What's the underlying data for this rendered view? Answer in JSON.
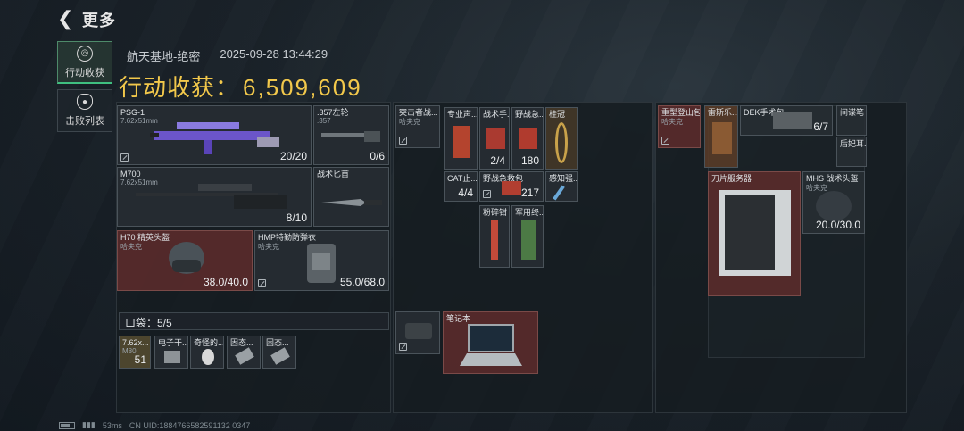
{
  "header": {
    "back_icon": "chevron-left-icon",
    "title": "更多"
  },
  "tabs": [
    {
      "label": "行动收获",
      "icon": "loot-icon",
      "active": true
    },
    {
      "label": "击败列表",
      "icon": "skull-icon",
      "active": false
    }
  ],
  "match": {
    "map": "航天基地-绝密",
    "datetime": "2025-09-28 13:44:29"
  },
  "earnings": {
    "label": "行动收获：",
    "value": "6,509,609"
  },
  "equipment": {
    "weapon1": {
      "name": "PSG-1",
      "caliber": "7.62x51mm",
      "count": "20/20"
    },
    "pistol": {
      "name": ".357左轮",
      "caliber": ".357",
      "count": "0/6"
    },
    "weapon2": {
      "name": "M700",
      "caliber": "7.62x51mm",
      "count": "8/10"
    },
    "knife": {
      "name": "战术匕首"
    },
    "helmet": {
      "name": "H70 精英头盔",
      "sub": "哈夫克",
      "durability": "38.0/40.0"
    },
    "armor": {
      "name": "HMP特勤防弹衣",
      "sub": "哈夫克",
      "durability": "55.0/68.0"
    }
  },
  "pockets": {
    "label": "口袋：5/5",
    "items": [
      {
        "name": "7.62x...",
        "sub": "M80",
        "count": "51"
      },
      {
        "name": "电子干...",
        "count": ""
      },
      {
        "name": "奇怪的...",
        "count": ""
      },
      {
        "name": "固态...",
        "count": ""
      },
      {
        "name": "固态...",
        "count": ""
      }
    ]
  },
  "chest_rig": {
    "name": "突击者战...",
    "sub": "哈夫克"
  },
  "chest_items": [
    {
      "name": "专业声...",
      "count": ""
    },
    {
      "name": "战术手...",
      "count": "2/4"
    },
    {
      "name": "野战急...",
      "count": "180"
    },
    {
      "name": "桂冠",
      "count": ""
    },
    {
      "name": "CAT止...",
      "count": "4/4"
    },
    {
      "name": "野战急救包",
      "count": "217"
    },
    {
      "name": "感知强...",
      "count": ""
    },
    {
      "name": "粉碎钳",
      "count": ""
    },
    {
      "name": "军用终...",
      "count": ""
    }
  ],
  "case": {
    "name": "笔记本"
  },
  "backpack": {
    "name": "重型登山包",
    "sub": "哈夫克"
  },
  "bag_items": [
    {
      "name": "雷斯乐...",
      "count": ""
    },
    {
      "name": "DEK手术包",
      "count": "6/7"
    },
    {
      "name": "间谍笔",
      "count": ""
    },
    {
      "name": "后妃耳...",
      "count": ""
    },
    {
      "name": "刀片服务器",
      "count": ""
    },
    {
      "name": "MHS 战术头盔",
      "sub": "哈夫克",
      "count": "20.0/30.0"
    }
  ],
  "status": {
    "ping": "53ms",
    "uid": "CN UID:1884766582591132 0347"
  }
}
